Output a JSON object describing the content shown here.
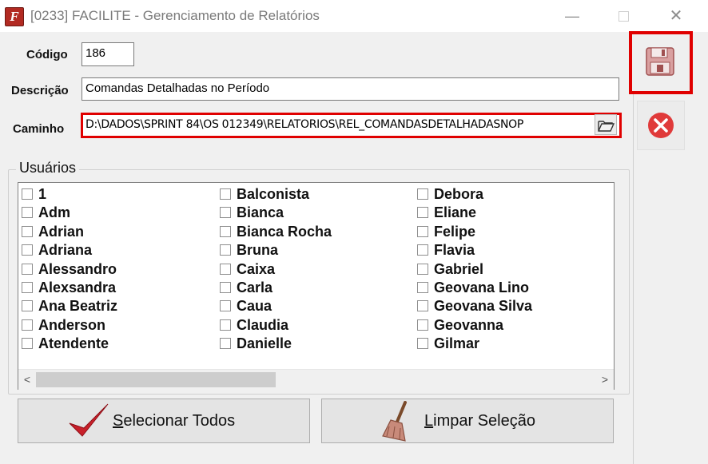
{
  "window": {
    "app_icon_letter": "F",
    "title": "[0233] FACILITE - Gerenciamento de Relatórios",
    "minimize_glyph": "—",
    "close_glyph": "✕"
  },
  "form": {
    "codigo_label": "Código",
    "codigo_value": "186",
    "descricao_label": "Descrição",
    "descricao_value": "Comandas Detalhadas no Período",
    "caminho_label": "Caminho",
    "caminho_value": "D:\\DADOS\\SPRINT 84\\OS 012349\\RELATORIOS\\REL_COMANDASDETALHADASNOP"
  },
  "users": {
    "title": "Usuários",
    "columns": [
      [
        "1",
        "Adm",
        "Adrian",
        "Adriana",
        "Alessandro",
        "Alexsandra",
        "Ana Beatriz",
        "Anderson",
        "Atendente"
      ],
      [
        "Balconista",
        "Bianca",
        "Bianca Rocha",
        "Bruna",
        "Caixa",
        "Carla",
        "Caua",
        "Claudia",
        "Danielle"
      ],
      [
        "Debora",
        "Eliane",
        "Felipe",
        "Flavia",
        "Gabriel",
        "Geovana Lino",
        "Geovana Silva",
        "Geovanna",
        "Gilmar"
      ]
    ],
    "scroll_left": "<",
    "scroll_right": ">"
  },
  "buttons": {
    "select_all_first": "S",
    "select_all_rest": "elecionar Todos",
    "clear_first": "L",
    "clear_rest": "impar Seleção"
  },
  "colors": {
    "highlight": "#e00000",
    "cancel": "#e03a3a",
    "check": "#c8202a"
  }
}
